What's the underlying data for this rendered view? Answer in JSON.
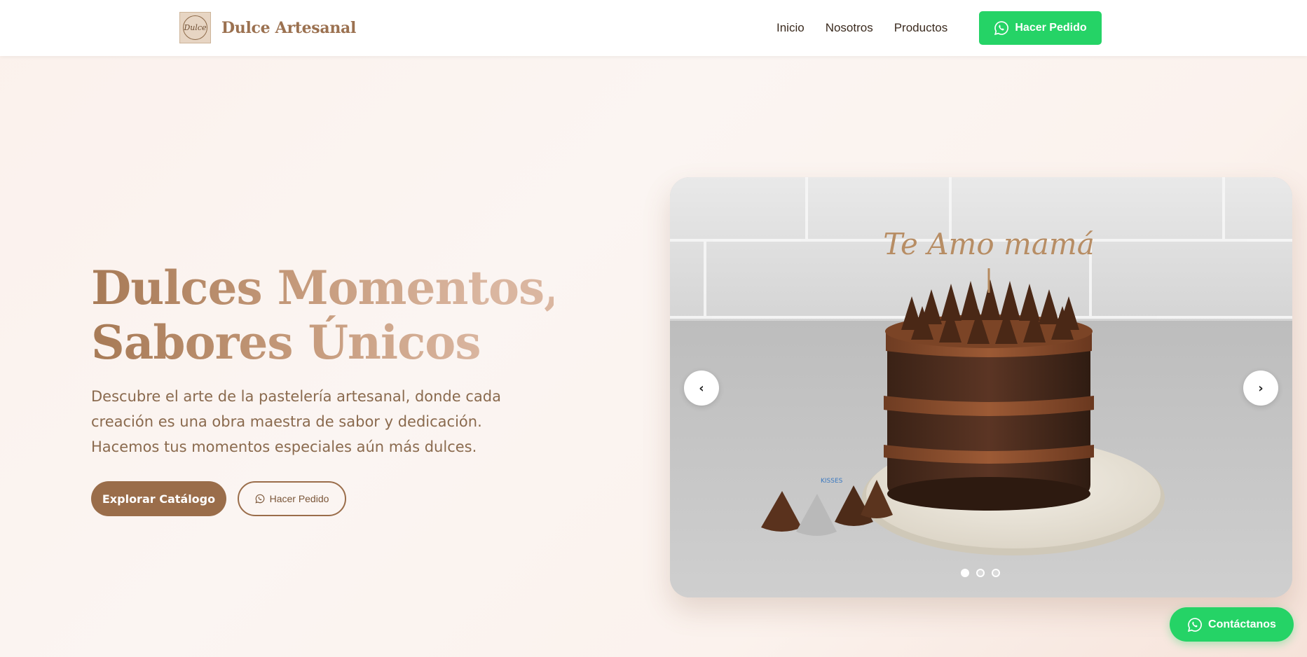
{
  "brand": {
    "name": "Dulce Artesanal",
    "logo_text": "Dulce",
    "logo_icon": "dulce-logo-icon"
  },
  "nav": {
    "items": [
      {
        "label": "Inicio"
      },
      {
        "label": "Nosotros"
      },
      {
        "label": "Productos"
      }
    ],
    "cta_label": "Hacer Pedido",
    "cta_icon": "whatsapp-icon"
  },
  "hero": {
    "title_line1": "Dulces Momentos,",
    "title_line2": "Sabores Únicos",
    "description": "Descubre el arte de la pastelería artesanal, donde cada creación es una obra maestra de sabor y dedicación. Hacemos tus momentos especiales aún más dulces.",
    "primary_button": "Explorar Catálogo",
    "secondary_button": "Hacer Pedido"
  },
  "carousel": {
    "prev_symbol": "‹",
    "next_symbol": "›",
    "slide_count": 3,
    "active_slide": 1,
    "topper_text": "Te Amo mamá",
    "wrapper_label": "KISSES"
  },
  "floating": {
    "contact_label": "Contáctanos",
    "contact_icon": "whatsapp-icon"
  },
  "colors": {
    "accent": "#9a6d4a",
    "whatsapp": "#25d366",
    "title_gradient_start": "#a77a56",
    "title_gradient_end": "#dab6a0"
  }
}
